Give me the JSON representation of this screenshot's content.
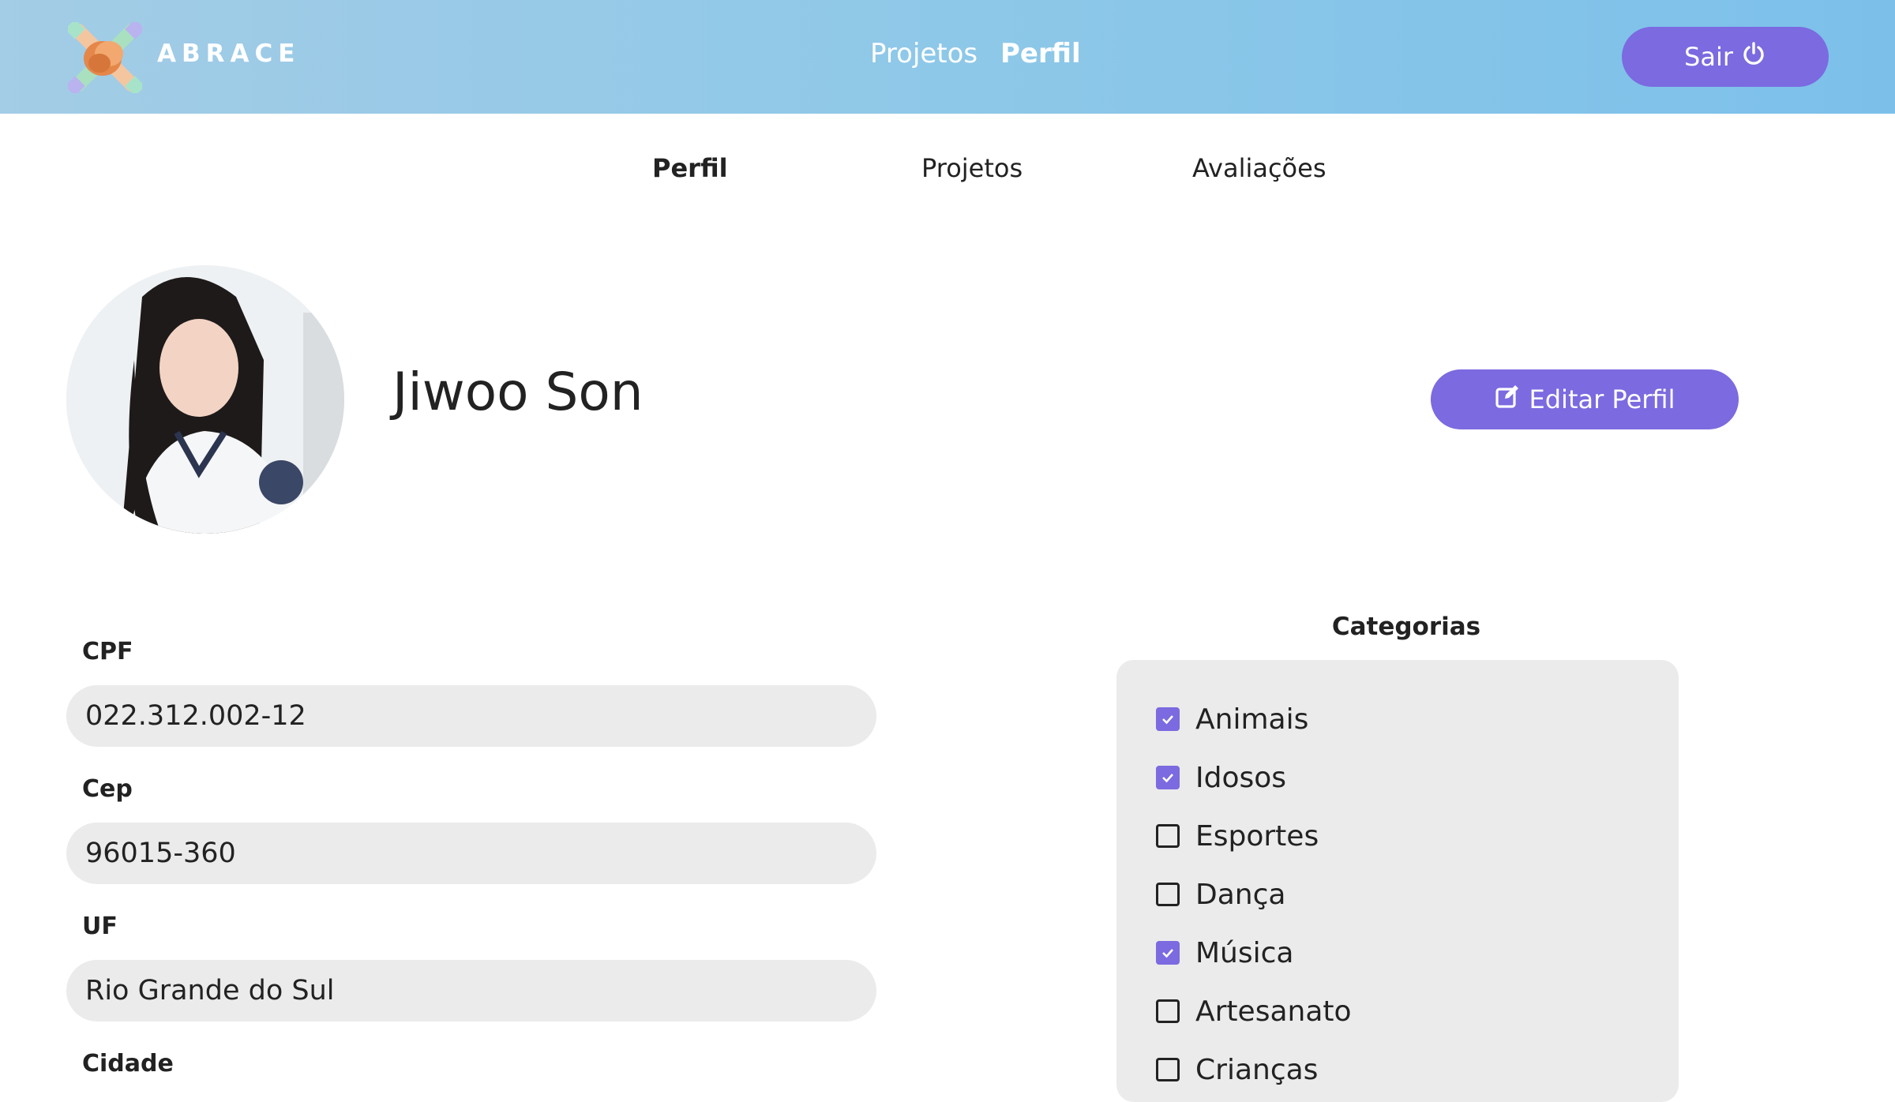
{
  "header": {
    "brand": "ABRACE",
    "nav": [
      {
        "label": "Projetos",
        "active": false
      },
      {
        "label": "Perfil",
        "active": true
      }
    ],
    "logout_label": "Sair",
    "logout_icon": "power-icon",
    "accent_color": "#7b6ae0"
  },
  "tabs": [
    {
      "label": "Perfil",
      "active": true
    },
    {
      "label": "Projetos",
      "active": false
    },
    {
      "label": "Avaliações",
      "active": false
    }
  ],
  "profile": {
    "name": "Jiwoo Son",
    "edit_label": "Editar Perfil",
    "edit_icon": "edit-icon"
  },
  "fields": [
    {
      "label": "CPF",
      "value": "022.312.002-12"
    },
    {
      "label": "Cep",
      "value": "96015-360"
    },
    {
      "label": "UF",
      "value": "Rio Grande do Sul"
    },
    {
      "label": "Cidade",
      "value": ""
    }
  ],
  "categories": {
    "title": "Categorias",
    "items": [
      {
        "label": "Animais",
        "checked": true
      },
      {
        "label": "Idosos",
        "checked": true
      },
      {
        "label": "Esportes",
        "checked": false
      },
      {
        "label": "Dança",
        "checked": false
      },
      {
        "label": "Música",
        "checked": true
      },
      {
        "label": "Artesanato",
        "checked": false
      },
      {
        "label": "Crianças",
        "checked": false
      }
    ]
  }
}
